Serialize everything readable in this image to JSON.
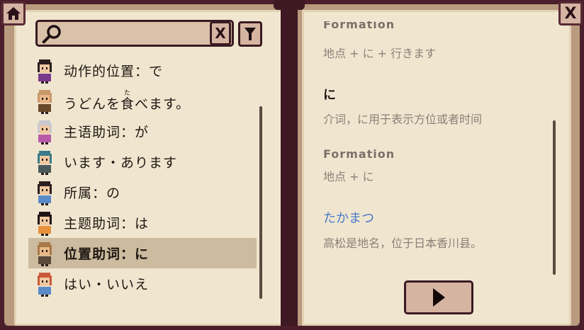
{
  "search": {
    "placeholder": "",
    "clear_label": "X"
  },
  "window": {
    "close_label": "X"
  },
  "list": {
    "items": [
      {
        "label": "动作的位置：で",
        "avatar": "girl-purple-avatar"
      },
      {
        "label": "うどんを食べます。",
        "ruby": "た",
        "avatar": "bald-monk-avatar"
      },
      {
        "label": "主语助词：が",
        "avatar": "old-woman-avatar"
      },
      {
        "label": "います・あります",
        "avatar": "teal-hair-avatar"
      },
      {
        "label": "所属：の",
        "avatar": "boy-avatar"
      },
      {
        "label": "主题助词：は",
        "avatar": "girl-orange-avatar"
      },
      {
        "label": "位置助词：に",
        "avatar": "bald-avatar",
        "selected": true
      },
      {
        "label": "はい・いいえ",
        "avatar": "red-hair-avatar"
      }
    ]
  },
  "detail": {
    "partial_heading": "Formation",
    "partial_formula": "地点 + に + 行きます",
    "term": "に",
    "term_desc": "介词，に用于表示方位或者时间",
    "formation_heading": "Formation",
    "formation_formula": "地点 + に",
    "example_term": "たかまつ",
    "example_desc": "高松是地名，位于日本香川县。"
  },
  "colors": {
    "accent_blue": "#4a78c8",
    "selected_bg": "#cdbb9f",
    "page_bg": "#f0e6d0",
    "frame": "#4a1e2a"
  }
}
